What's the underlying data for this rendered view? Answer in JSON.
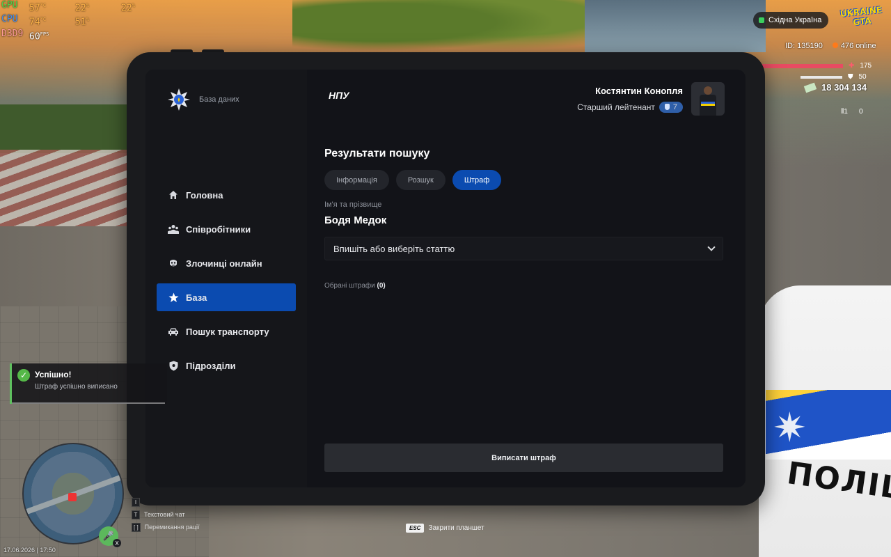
{
  "hud": {
    "perf": [
      {
        "label": "GPU",
        "v1": "57",
        "u1": "°C",
        "v2": "22",
        "u2": "%",
        "v3": "22",
        "u3": "%"
      },
      {
        "label": "CPU",
        "v1": "74",
        "u1": "°C",
        "v2": "51",
        "u2": "%"
      },
      {
        "label": "D3D9",
        "v1": "60",
        "u1": "FPS"
      }
    ],
    "region": "Східна Україна",
    "logo_line1": "UKRAINE",
    "logo_line2": "GTA",
    "player_id": "ID: 135190",
    "online": "476 online",
    "health": "175",
    "armor": "50",
    "money": "18 304 134",
    "ammo_clip": "1",
    "ammo_total": "0"
  },
  "tablet": {
    "brand_sub": "База даних",
    "brand_main": "НПУ",
    "nav": [
      {
        "label": "Головна",
        "icon": "home-icon"
      },
      {
        "label": "Співробітники",
        "icon": "people-icon"
      },
      {
        "label": "Злочинці онлайн",
        "icon": "mask-icon"
      },
      {
        "label": "База",
        "icon": "star-icon",
        "active": true
      },
      {
        "label": "Пошук транспорту",
        "icon": "car-icon"
      },
      {
        "label": "Підрозділи",
        "icon": "shield-icon"
      }
    ],
    "user": {
      "name": "Костянтин Конопля",
      "rank": "Старший лейтенант",
      "rank_level": "7"
    },
    "results_title": "Результати пошуку",
    "tabs": [
      {
        "label": "Інформація",
        "active": false
      },
      {
        "label": "Розшук",
        "active": false
      },
      {
        "label": "Штраф",
        "active": true
      }
    ],
    "name_label": "Ім'я та прізвище",
    "person_name": "Бодя Медок",
    "article_placeholder": "Впишіть або виберіть статтю",
    "selected_fines_label": "Обрані штрафи",
    "selected_fines_count": "(0)",
    "issue_button": "Виписати штраф"
  },
  "notification": {
    "title": "Успішно!",
    "text": "Штраф успішно виписано"
  },
  "hints": {
    "chat_key": "T",
    "chat_label": "Текстовий чат",
    "radio_keys": "[ ]",
    "radio_label": "Перемикання рації",
    "esc_key": "ESC",
    "esc_label": "Закрити планшет",
    "mic_key": "X"
  },
  "datetime": "17.06.2026 | 17:50",
  "scene": {
    "car_text": "ПОЛІЦІЯ"
  },
  "colors": {
    "accent": "#0b4bb0",
    "success": "#55b848",
    "panel": "#121318"
  }
}
